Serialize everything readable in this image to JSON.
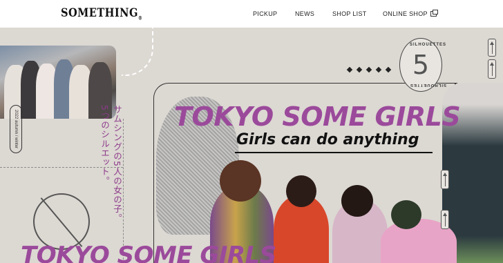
{
  "header": {
    "logo": "SOMETHING",
    "logo_mark": "®",
    "nav": [
      {
        "label": "PICKUP"
      },
      {
        "label": "NEWS"
      },
      {
        "label": "SHOP LIST"
      },
      {
        "label": "ONLINE SHOP",
        "icon": "external-link-icon"
      }
    ]
  },
  "hero": {
    "season": "2022 autumn / winter",
    "title": "TOKYO SOME GIRLS",
    "tagline": "Girls can do anything",
    "jp_copy_line1": "サムシングの5人の女の子。",
    "jp_copy_line2": "5つのシルエット。",
    "badge_number": "5",
    "badge_text": "SILHOUETTES",
    "bottom_title": "TOKYO SOME GIRLS"
  },
  "colors": {
    "accent": "#9b4a9b",
    "background": "#dcd8d2",
    "header_bg": "#ffffff",
    "text_dark": "#111111"
  }
}
